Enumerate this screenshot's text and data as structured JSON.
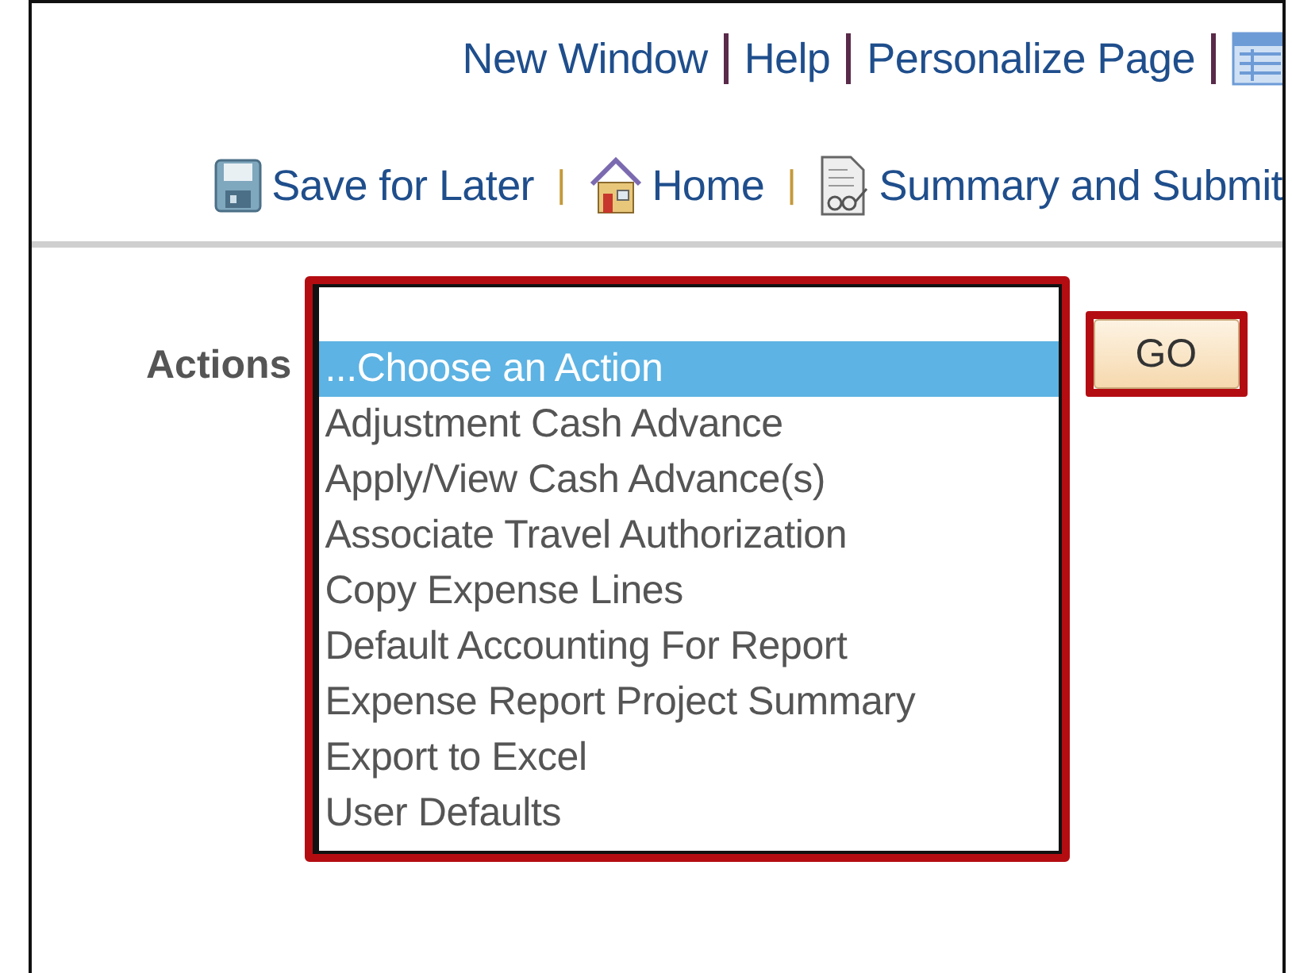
{
  "header_links": [
    {
      "label": "New Window"
    },
    {
      "label": "Help"
    },
    {
      "label": "Personalize Page"
    }
  ],
  "toolbar": [
    {
      "kind": "link",
      "label": "Save for Later"
    },
    {
      "kind": "separator",
      "label": "|"
    },
    {
      "kind": "link",
      "label": "Home"
    },
    {
      "kind": "separator",
      "label": "|"
    },
    {
      "kind": "link",
      "label": "Summary and Submit"
    }
  ],
  "actions": {
    "label": "Actions",
    "highlighted": true,
    "options": [
      {
        "label": "...Choose an Action",
        "selected": true
      },
      {
        "label": "Adjustment Cash Advance",
        "selected": false
      },
      {
        "label": "Apply/View Cash Advance(s)",
        "selected": false
      },
      {
        "label": "Associate Travel Authorization",
        "selected": false
      },
      {
        "label": "Copy Expense Lines",
        "selected": false
      },
      {
        "label": "Default Accounting For Report",
        "selected": false
      },
      {
        "label": "Expense Report Project Summary",
        "selected": false
      },
      {
        "label": "Export to Excel",
        "selected": false
      },
      {
        "label": "User Defaults",
        "selected": false
      }
    ],
    "go_button": {
      "label": "GO",
      "highlighted": true
    }
  }
}
